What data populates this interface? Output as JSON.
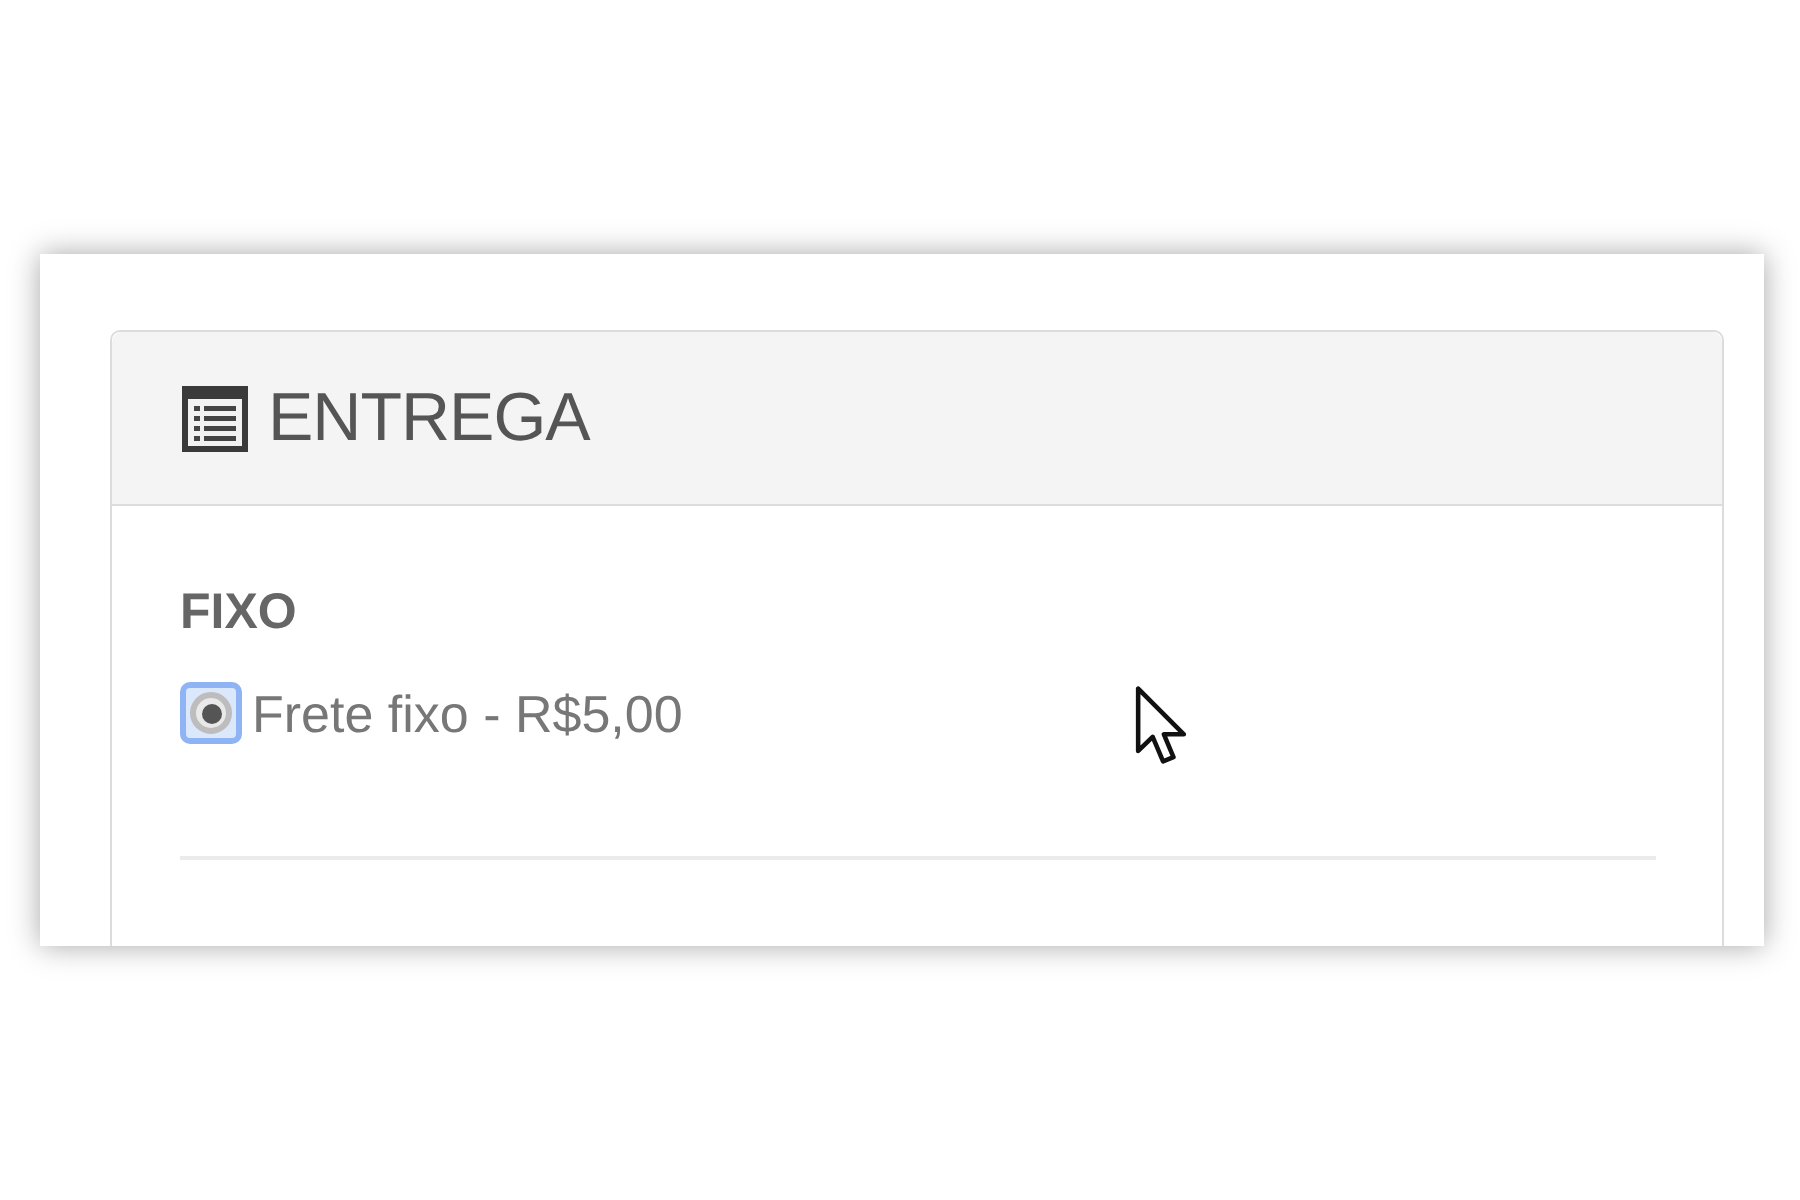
{
  "panel": {
    "title": "ENTREGA"
  },
  "shipping_group": {
    "label": "FIXO",
    "options": [
      {
        "label": "Frete fixo - R$5,00",
        "selected": true,
        "focused": true
      }
    ]
  }
}
